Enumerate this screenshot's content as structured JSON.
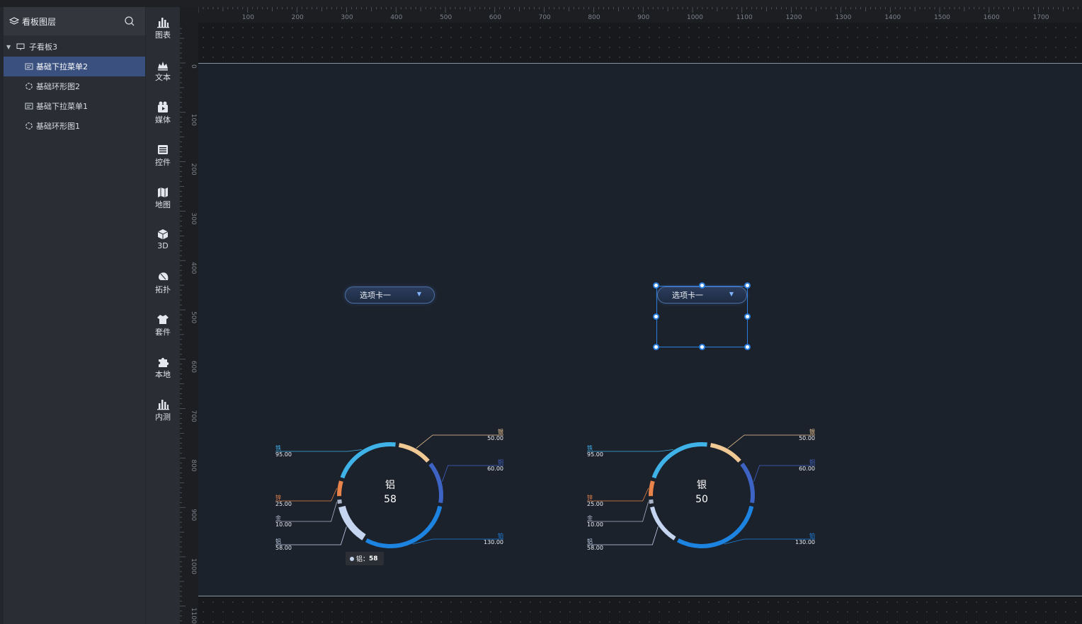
{
  "layer_panel": {
    "title": "看板图层",
    "root_label": "子看板3",
    "items": [
      {
        "label": "基础下拉菜单2",
        "icon": "dropdown-icon",
        "selected": true
      },
      {
        "label": "基础环形图2",
        "icon": "ring-icon",
        "selected": false
      },
      {
        "label": "基础下拉菜单1",
        "icon": "dropdown-icon",
        "selected": false
      },
      {
        "label": "基础环形图1",
        "icon": "ring-icon",
        "selected": false
      }
    ]
  },
  "toolbox": {
    "items": [
      {
        "label": "图表",
        "icon": "bar-chart-icon"
      },
      {
        "label": "文本",
        "icon": "text-icon"
      },
      {
        "label": "媒体",
        "icon": "media-icon"
      },
      {
        "label": "控件",
        "icon": "control-icon"
      },
      {
        "label": "地图",
        "icon": "map-icon"
      },
      {
        "label": "3D",
        "icon": "cube-icon"
      },
      {
        "label": "拓扑",
        "icon": "topology-icon"
      },
      {
        "label": "套件",
        "icon": "suite-icon"
      },
      {
        "label": "本地",
        "icon": "puzzle-icon"
      },
      {
        "label": "内测",
        "icon": "beta-chart-icon"
      }
    ]
  },
  "rulers": {
    "top_labels": [
      "100",
      "200",
      "300",
      "400",
      "500",
      "600",
      "700",
      "800",
      "900",
      "1000",
      "1100",
      "1200",
      "1300",
      "1400",
      "1500",
      "1600",
      "1700"
    ],
    "left_labels": [
      "0",
      "100",
      "200",
      "300",
      "400",
      "500",
      "600",
      "700",
      "800",
      "900",
      "1000",
      "1100"
    ]
  },
  "dropdowns": [
    {
      "value": "选项卡一"
    },
    {
      "value": "选项卡一"
    }
  ],
  "tooltip": {
    "label": "铝：",
    "value": "58"
  },
  "colors": {
    "selection": "#2b7fe0",
    "board_bg": "#1c222c",
    "selected_layer": "#3a5180"
  },
  "chart_data": [
    {
      "type": "pie",
      "variant": "ring",
      "center_label": "铝",
      "center_value": "58",
      "highlighted": "铝",
      "slices": [
        {
          "name": "银",
          "value": 50,
          "label": "50.00",
          "color": "#f0c995"
        },
        {
          "name": "铜",
          "value": 60,
          "label": "60.00",
          "color": "#3d63c4"
        },
        {
          "name": "铂",
          "value": 130,
          "label": "130.00",
          "color": "#1c83e0"
        },
        {
          "name": "铝",
          "value": 58,
          "label": "58.00",
          "color": "#c5d4ef"
        },
        {
          "name": "金",
          "value": 10,
          "label": "10.00",
          "color": "#aab4c8"
        },
        {
          "name": "锌",
          "value": 25,
          "label": "25.00",
          "color": "#e8834a"
        },
        {
          "name": "铁",
          "value": 95,
          "label": "95.00",
          "color": "#3fb3e8"
        }
      ]
    },
    {
      "type": "pie",
      "variant": "ring",
      "center_label": "银",
      "center_value": "50",
      "highlighted": "",
      "slices": [
        {
          "name": "银",
          "value": 50,
          "label": "50.00",
          "color": "#f0c995"
        },
        {
          "name": "铜",
          "value": 60,
          "label": "60.00",
          "color": "#3d63c4"
        },
        {
          "name": "铂",
          "value": 130,
          "label": "130.00",
          "color": "#1c83e0"
        },
        {
          "name": "铝",
          "value": 58,
          "label": "58.00",
          "color": "#c5d4ef"
        },
        {
          "name": "金",
          "value": 10,
          "label": "10.00",
          "color": "#aab4c8"
        },
        {
          "name": "锌",
          "value": 25,
          "label": "25.00",
          "color": "#e8834a"
        },
        {
          "name": "铁",
          "value": 95,
          "label": "95.00",
          "color": "#3fb3e8"
        }
      ]
    }
  ]
}
